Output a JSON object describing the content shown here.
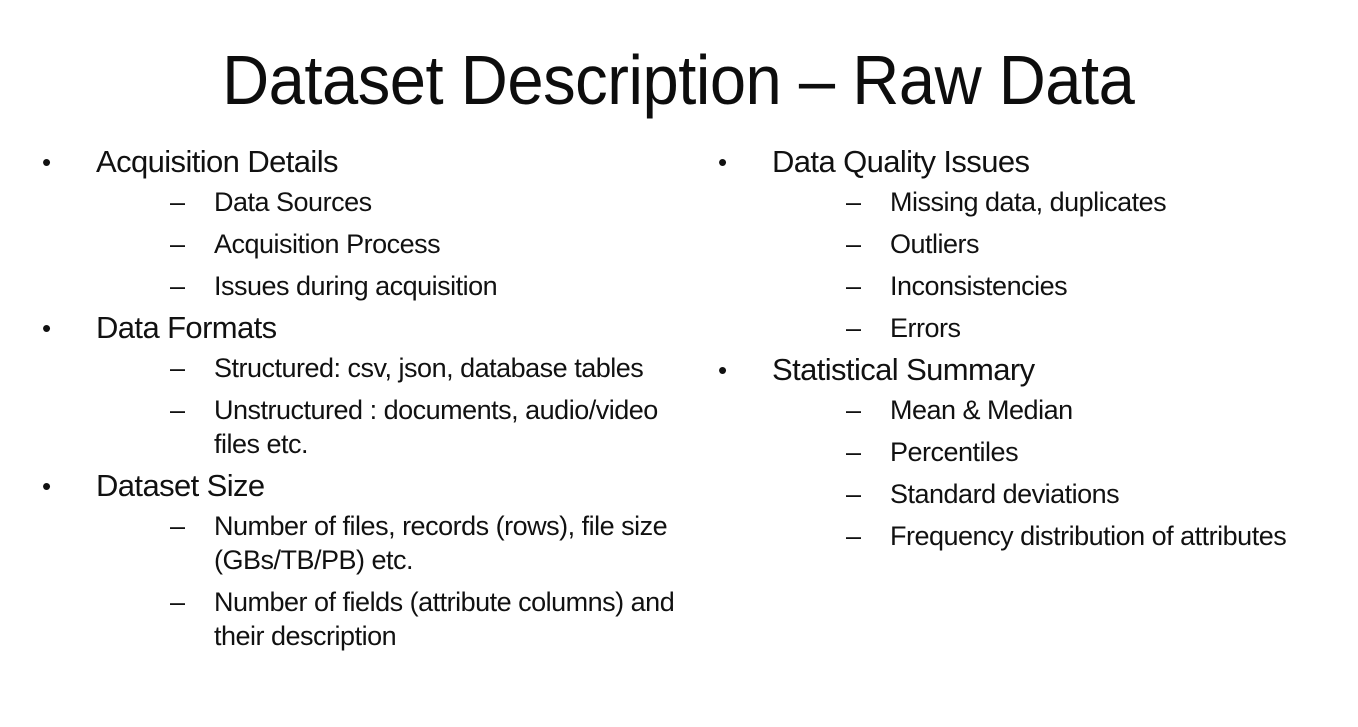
{
  "slide": {
    "title": "Dataset Description – Raw Data",
    "bullet_glyph": "•",
    "dash_glyph": "–",
    "columns": [
      {
        "sections": [
          {
            "heading": "Acquisition Details",
            "items": [
              "Data Sources",
              "Acquisition Process",
              "Issues during acquisition"
            ]
          },
          {
            "heading": "Data Formats",
            "items": [
              "Structured: csv, json, database tables",
              "Unstructured : documents, audio/video files etc."
            ]
          },
          {
            "heading": "Dataset Size",
            "items": [
              "Number of files, records (rows), file size (GBs/TB/PB) etc.",
              "Number of fields (attribute columns) and their description"
            ]
          }
        ]
      },
      {
        "sections": [
          {
            "heading": "Data Quality Issues",
            "items": [
              "Missing data, duplicates",
              "Outliers",
              "Inconsistencies",
              "Errors"
            ]
          },
          {
            "heading": "Statistical Summary",
            "items": [
              "Mean & Median",
              "Percentiles",
              "Standard deviations",
              "Frequency distribution of attributes"
            ]
          }
        ]
      }
    ]
  }
}
